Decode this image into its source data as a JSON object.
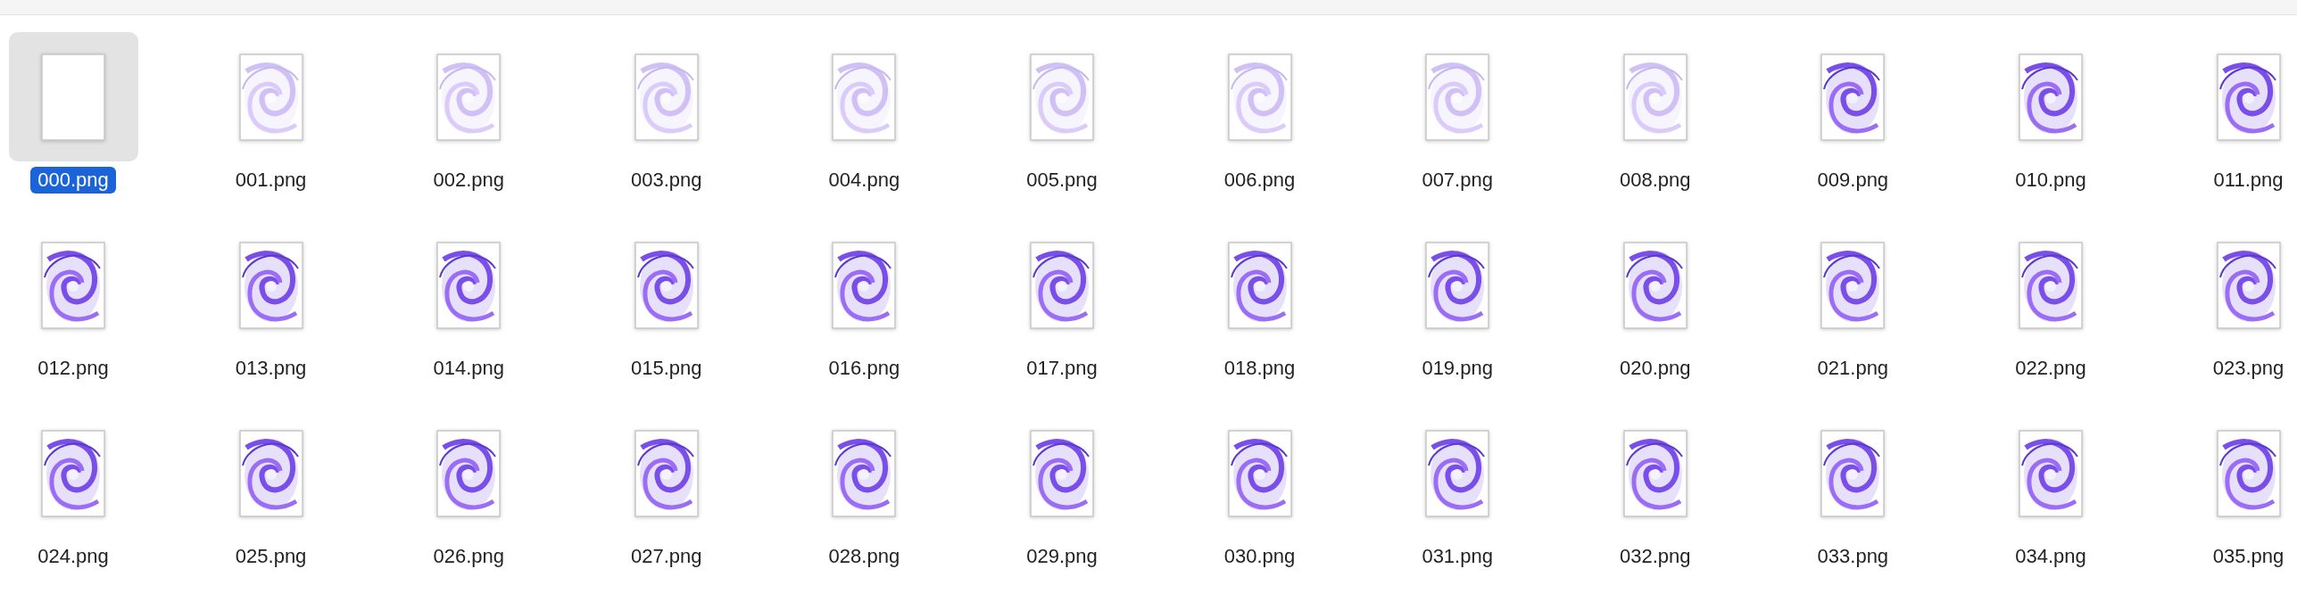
{
  "files": [
    {
      "name": "000.png",
      "selected": true,
      "kind": "blank"
    },
    {
      "name": "001.png",
      "selected": false,
      "kind": "faint"
    },
    {
      "name": "002.png",
      "selected": false,
      "kind": "faint"
    },
    {
      "name": "003.png",
      "selected": false,
      "kind": "faint"
    },
    {
      "name": "004.png",
      "selected": false,
      "kind": "faint"
    },
    {
      "name": "005.png",
      "selected": false,
      "kind": "faint"
    },
    {
      "name": "006.png",
      "selected": false,
      "kind": "faint"
    },
    {
      "name": "007.png",
      "selected": false,
      "kind": "faint"
    },
    {
      "name": "008.png",
      "selected": false,
      "kind": "faint"
    },
    {
      "name": "009.png",
      "selected": false,
      "kind": "swirl"
    },
    {
      "name": "010.png",
      "selected": false,
      "kind": "swirl"
    },
    {
      "name": "011.png",
      "selected": false,
      "kind": "swirl"
    },
    {
      "name": "012.png",
      "selected": false,
      "kind": "swirl"
    },
    {
      "name": "013.png",
      "selected": false,
      "kind": "swirl"
    },
    {
      "name": "014.png",
      "selected": false,
      "kind": "swirl"
    },
    {
      "name": "015.png",
      "selected": false,
      "kind": "swirl"
    },
    {
      "name": "016.png",
      "selected": false,
      "kind": "swirl"
    },
    {
      "name": "017.png",
      "selected": false,
      "kind": "swirl"
    },
    {
      "name": "018.png",
      "selected": false,
      "kind": "swirl"
    },
    {
      "name": "019.png",
      "selected": false,
      "kind": "swirl"
    },
    {
      "name": "020.png",
      "selected": false,
      "kind": "swirl"
    },
    {
      "name": "021.png",
      "selected": false,
      "kind": "swirl"
    },
    {
      "name": "022.png",
      "selected": false,
      "kind": "swirl"
    },
    {
      "name": "023.png",
      "selected": false,
      "kind": "swirl"
    },
    {
      "name": "024.png",
      "selected": false,
      "kind": "swirl"
    },
    {
      "name": "025.png",
      "selected": false,
      "kind": "swirl"
    },
    {
      "name": "026.png",
      "selected": false,
      "kind": "swirl"
    },
    {
      "name": "027.png",
      "selected": false,
      "kind": "swirl"
    },
    {
      "name": "028.png",
      "selected": false,
      "kind": "swirl"
    },
    {
      "name": "029.png",
      "selected": false,
      "kind": "swirl"
    },
    {
      "name": "030.png",
      "selected": false,
      "kind": "swirl"
    },
    {
      "name": "031.png",
      "selected": false,
      "kind": "swirl"
    },
    {
      "name": "032.png",
      "selected": false,
      "kind": "swirl"
    },
    {
      "name": "033.png",
      "selected": false,
      "kind": "swirl"
    },
    {
      "name": "034.png",
      "selected": false,
      "kind": "swirl"
    },
    {
      "name": "035.png",
      "selected": false,
      "kind": "swirl"
    }
  ]
}
